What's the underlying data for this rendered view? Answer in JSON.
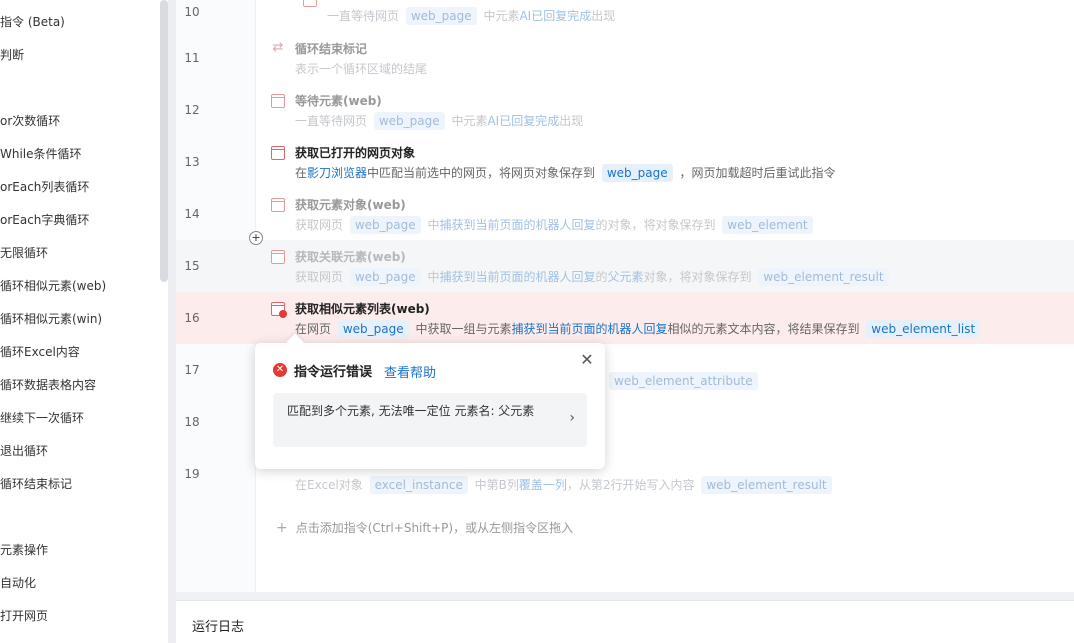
{
  "sidebar": {
    "items": [
      {
        "label": "指令 (Beta)"
      },
      {
        "label": "判断"
      },
      {
        "label": "or次数循环"
      },
      {
        "label": "While条件循环"
      },
      {
        "label": "orEach列表循环"
      },
      {
        "label": "orEach字典循环"
      },
      {
        "label": "无限循环"
      },
      {
        "label": "循环相似元素(web)"
      },
      {
        "label": "循环相似元素(win)"
      },
      {
        "label": "循环Excel内容"
      },
      {
        "label": "循环数据表格内容"
      },
      {
        "label": "继续下一次循环"
      },
      {
        "label": "退出循环"
      },
      {
        "label": "循环结束标记"
      },
      {
        "label": "元素操作"
      },
      {
        "label": "自动化"
      },
      {
        "label": "打开网页"
      }
    ]
  },
  "rows": [
    {
      "num": "10",
      "title": "",
      "desc_parts": [
        "一直等待网页 ",
        "web_page",
        " 中元素",
        "AI已回复完成",
        "出现"
      ]
    },
    {
      "num": "11",
      "title": "循环结束标记",
      "desc": "表示一个循环区域的结尾"
    },
    {
      "num": "12",
      "title": "等待元素(web)",
      "desc_parts": [
        "一直等待网页 ",
        "web_page",
        " 中元素",
        "AI已回复完成",
        "出现"
      ]
    },
    {
      "num": "13",
      "title": "获取已打开的网页对象",
      "desc_parts": [
        "在",
        "影刀浏览器",
        "中匹配当前选中的网页，将网页对象保存到 ",
        "web_page",
        " ，网页加载超时后重试此指令"
      ]
    },
    {
      "num": "14",
      "title": "获取元素对象(web)",
      "desc_parts": [
        "获取网页 ",
        "web_page",
        " 中",
        "捕获到当前页面的机器人回复",
        "的对象，将对象保存到 ",
        "web_element"
      ]
    },
    {
      "num": "15",
      "title": "获取关联元素(web)",
      "desc_parts": [
        "获取网页 ",
        "web_page",
        " 中",
        "捕获到当前页面的机器人回复",
        "的",
        "父元素",
        "对象，将对象保存到 ",
        "web_element_result"
      ]
    },
    {
      "num": "16",
      "title": "获取相似元素列表(web)",
      "desc_parts": [
        "在网页 ",
        "web_page",
        " 中获取一组与元素",
        "捕获到当前页面的机器人回复",
        "相似的元素文本内容，将结果保存到 ",
        "web_element_list"
      ]
    },
    {
      "num": "17",
      "desc_tag": "web_element_attribute"
    },
    {
      "num": "18"
    },
    {
      "num": "19",
      "desc_parts": [
        "在Excel对象 ",
        "excel_instance",
        " 中第B列",
        "覆盖一列",
        "，从第2行开始写入内容 ",
        "web_element_result"
      ]
    }
  ],
  "add_instruction": "点击添加指令(Ctrl+Shift+P)，或从左侧指令区拖入",
  "popover": {
    "title": "指令运行错误",
    "help_link": "查看帮助",
    "message": "匹配到多个元素, 无法唯一定位 元素名: 父元素",
    "close_icon": "close-icon",
    "chevron_icon": "chevron-right-icon"
  },
  "log_panel": {
    "title": "运行日志"
  },
  "colors": {
    "error_bg": "#fdecec",
    "link": "#1a73c8",
    "error_icon": "#e53935"
  }
}
